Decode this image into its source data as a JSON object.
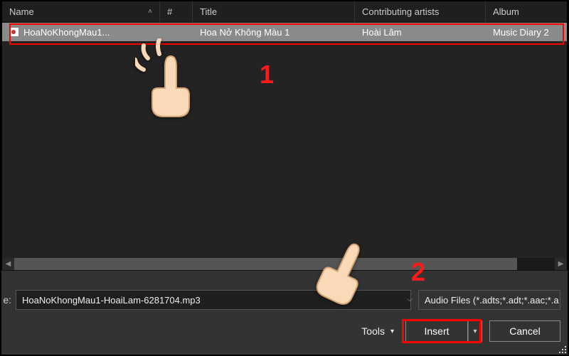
{
  "columns": {
    "name": "Name",
    "num": "#",
    "title": "Title",
    "artist": "Contributing artists",
    "album": "Album"
  },
  "row": {
    "name": "HoaNoKhongMau1...",
    "num": "",
    "title": "Hoa Nở Không Màu 1",
    "artist": "Hoài Lâm",
    "album": "Music Diary 2"
  },
  "file_row_label": "e:",
  "filename": "HoaNoKhongMau1-HoaiLam-6281704.mp3",
  "filter": "Audio Files (*.adts;*.adt;*.aac;*.a",
  "tools_label": "Tools",
  "insert_label": "Insert",
  "cancel_label": "Cancel",
  "annotations": {
    "one": "1",
    "two": "2"
  }
}
